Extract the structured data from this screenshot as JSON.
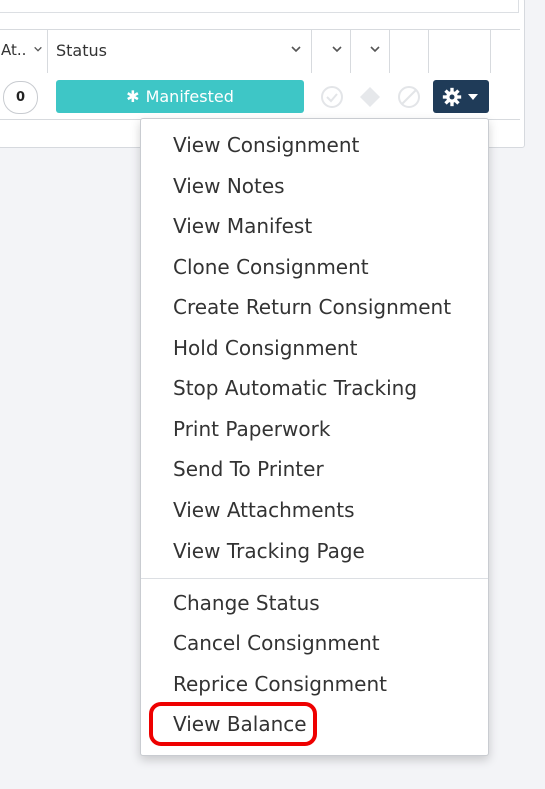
{
  "table": {
    "headers": [
      {
        "label": "At..",
        "icon": "chevron-down-icon"
      },
      {
        "label": "Status",
        "icon": "chevron-down-icon"
      },
      {
        "label": "",
        "icon": "chevron-down-icon"
      },
      {
        "label": "",
        "icon": "chevron-down-icon"
      }
    ],
    "row": {
      "count": "0",
      "status": "Manifested",
      "status_color": "#3ec6c6",
      "actions_button_color": "#1f3b58"
    }
  },
  "menu": {
    "group1": [
      "View Consignment",
      "View Notes",
      "View Manifest",
      "Clone Consignment",
      "Create Return Consignment",
      "Hold Consignment",
      "Stop Automatic Tracking",
      "Print Paperwork",
      "Send To Printer",
      "View Attachments",
      "View Tracking Page"
    ],
    "group2": [
      "Change Status",
      "Cancel Consignment",
      "Reprice Consignment",
      "View Balance"
    ],
    "highlighted_item": "View Balance",
    "highlight_color": "#ee0000"
  }
}
